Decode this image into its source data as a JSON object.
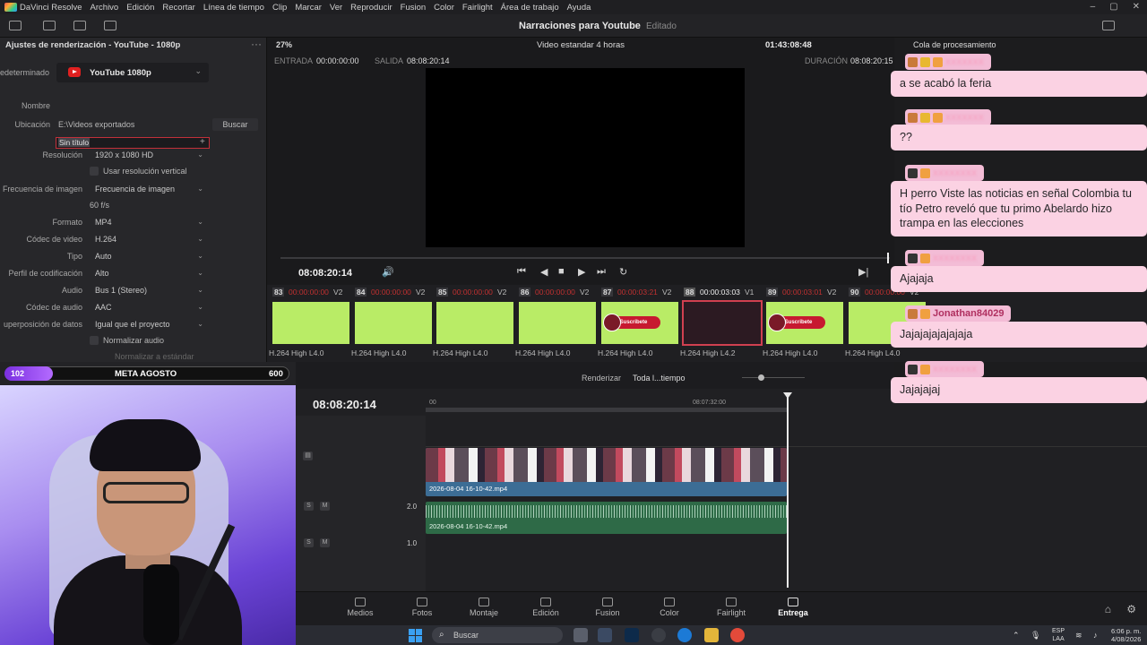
{
  "app": {
    "menu": [
      "DaVinci Resolve",
      "Archivo",
      "Edición",
      "Recortar",
      "Línea de tiempo",
      "Clip",
      "Marcar",
      "Ver",
      "Reproducir",
      "Fusion",
      "Color",
      "Fairlight",
      "Área de trabajo",
      "Ayuda"
    ],
    "project_title": "Narraciones para Youtube",
    "project_state": "Editado"
  },
  "render_settings": {
    "title": "Ajustes de renderización - YouTube - 1080p",
    "preset_label_cut": "edeterminado",
    "preset_value": "YouTube 1080p",
    "name_label": "Nombre",
    "name_value": "Sin título",
    "location_label": "Ubicación",
    "location_value": "E:\\Videos exportados",
    "browse_label": "Buscar",
    "fields": [
      {
        "label": "Resolución",
        "value": "1920 x 1080 HD"
      },
      {
        "label": "Frecuencia de imagen",
        "value": "Frecuencia de imagen"
      },
      {
        "label": "Formato",
        "value": "MP4"
      },
      {
        "label": "Códec de video",
        "value": "H.264"
      },
      {
        "label": "Tipo",
        "value": "Auto"
      },
      {
        "label": "Perfil de codificación",
        "value": "Alto"
      },
      {
        "label": "Audio",
        "value": "Bus 1 (Stereo)"
      },
      {
        "label": "Códec de audio",
        "value": "AAC"
      },
      {
        "label": "uperposición de datos",
        "value": "Igual que el proyecto"
      }
    ],
    "vertical_res_label": "Usar resolución vertical",
    "fps_value": "60 f/s",
    "normalize_label": "Normalizar audio",
    "normalize_sub": "Normalizar a estándar"
  },
  "viewer": {
    "zoom": "27%",
    "view_title": "Video estandar 4 horas",
    "timecode": "01:43:08:48",
    "in_label": "ENTRADA",
    "in_value": "00:00:00:00",
    "out_label": "SALIDA",
    "out_value": "08:08:20:14",
    "duration_label": "DURACIÓN",
    "duration_value": "08:08:20:15",
    "transport_tc": "08:08:20:14"
  },
  "clips": [
    {
      "num": "83",
      "tc": "00:00:00:00",
      "track": "V2",
      "fmt": "H.264 High L4.0",
      "kind": "green"
    },
    {
      "num": "84",
      "tc": "00:00:00:00",
      "track": "V2",
      "fmt": "H.264 High L4.0",
      "kind": "green"
    },
    {
      "num": "85",
      "tc": "00:00:00:00",
      "track": "V2",
      "fmt": "H.264 High L4.0",
      "kind": "green"
    },
    {
      "num": "86",
      "tc": "00:00:00:00",
      "track": "V2",
      "fmt": "H.264 High L4.0",
      "kind": "green"
    },
    {
      "num": "87",
      "tc": "00:00:03:21",
      "track": "V2",
      "fmt": "H.264 High L4.0",
      "kind": "sub"
    },
    {
      "num": "88",
      "tc": "00:00:03:03",
      "track": "V1",
      "fmt": "H.264 High L4.2",
      "kind": "sel"
    },
    {
      "num": "89",
      "tc": "00:00:03:01",
      "track": "V2",
      "fmt": "H.264 High L4.0",
      "kind": "sub"
    },
    {
      "num": "90",
      "tc": "00:00:00:00",
      "track": "V2",
      "fmt": "H.264 High L4.0",
      "kind": "sub"
    }
  ],
  "render_row": {
    "label": "Renderizar",
    "value": "Toda l...tiempo"
  },
  "timeline": {
    "timecode": "08:08:20:14",
    "ruler_start": "00",
    "ruler_mid": "08:07:32:00",
    "video_clip_name": "2026-08-04 16-10-42.mp4",
    "audio_clip_name": "2026-08-04 16-10-42.mp4",
    "track_levels": [
      "2.0",
      "1.0"
    ]
  },
  "pages": [
    "Medios",
    "Fotos",
    "Montaje",
    "Edición",
    "Fusion",
    "Color",
    "Fairlight",
    "Entrega"
  ],
  "active_page": "Entrega",
  "taskbar": {
    "search_placeholder": "Buscar",
    "lang_top": "ESP",
    "lang_bottom": "LAA",
    "time": "6:06 p. m.",
    "date": "4/08/2026"
  },
  "meta": {
    "current": "102",
    "label": "META AGOSTO",
    "goal": "600",
    "progress_fraction": 0.17
  },
  "chat": {
    "queue_title": "Cola de procesamiento",
    "visible_user": "Jonathan84029",
    "messages": [
      "a se acabó la feria",
      "??",
      "H perro Viste las noticias en señal Colombia tu tío Petro reveló que tu primo Abelardo hizo trampa en las elecciones",
      "Ajajaja",
      "Jajajajajajajaja",
      "Jajajajaj"
    ]
  },
  "colors": {
    "accent_red": "#c2303a",
    "clip_green": "#b9ec66",
    "chat_pink": "#fbd2e3",
    "meta_purple": "#7a2fe0"
  }
}
